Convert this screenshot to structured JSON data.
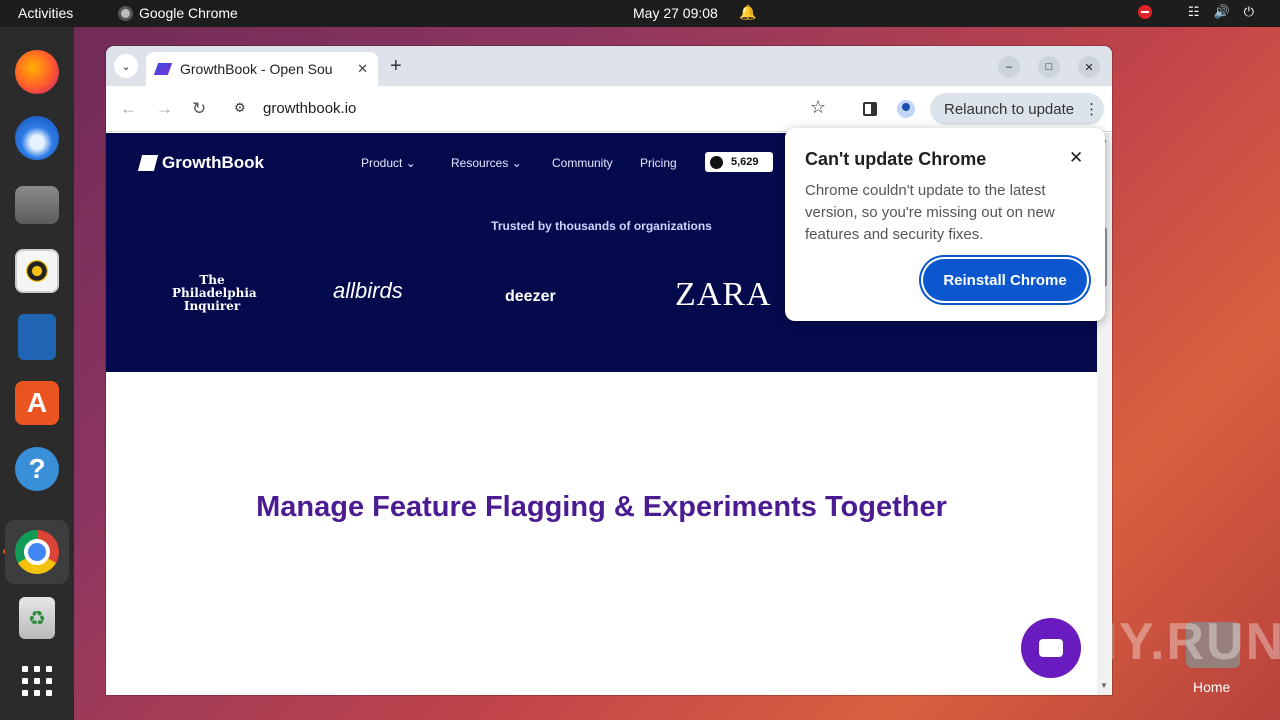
{
  "topbar": {
    "activities": "Activities",
    "app_name": "Google Chrome",
    "datetime": "May 27  09:08"
  },
  "dock": {
    "items": [
      "firefox",
      "thunderbird",
      "files",
      "rhythmbox",
      "libreoffice-writer",
      "app-center",
      "help",
      "google-chrome",
      "trash",
      "show-apps"
    ]
  },
  "browser": {
    "tab_title": "GrowthBook - Open Sou",
    "url": "growthbook.io",
    "relaunch_label": "Relaunch to update"
  },
  "site": {
    "brand": "GrowthBook",
    "nav": [
      "Product",
      "Resources",
      "Community",
      "Pricing"
    ],
    "github_stars": "5,629",
    "trusted": "Trusted by thousands of organizations",
    "logos": {
      "philadelphia": "The Philadelphia Inquirer",
      "allbirds": "allbirds",
      "deezer": "deezer",
      "zara": "ZARA"
    },
    "headline": "Manage Feature Flagging & Experiments Together"
  },
  "popup": {
    "title": "Can't update Chrome",
    "body": "Chrome couldn't update to the latest version, so you're missing out on new features and security fixes.",
    "button": "Reinstall Chrome"
  },
  "desktop": {
    "home_label": "Home",
    "watermark": "ANY.RUN"
  },
  "colors": {
    "hero_bg": "#040a4c",
    "headline": "#4b1c91",
    "accent_button": "#0b57d0"
  }
}
